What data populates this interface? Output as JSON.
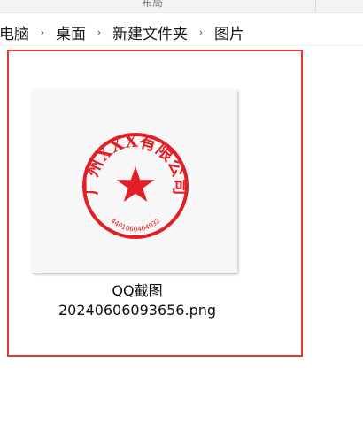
{
  "header": {
    "top_label": "布局"
  },
  "breadcrumb": {
    "items": [
      "电脑",
      "桌面",
      "新建文件夹",
      "图片"
    ],
    "separator": "›"
  },
  "file": {
    "name_line1": "QQ截图",
    "name_line2": "20240606093656.png",
    "selected_color": "#e53935",
    "thumbnail": {
      "stamp_color": "#e21f26",
      "stamp_top_text": "广州XXX有限公司",
      "stamp_number": "4401060464032"
    }
  }
}
